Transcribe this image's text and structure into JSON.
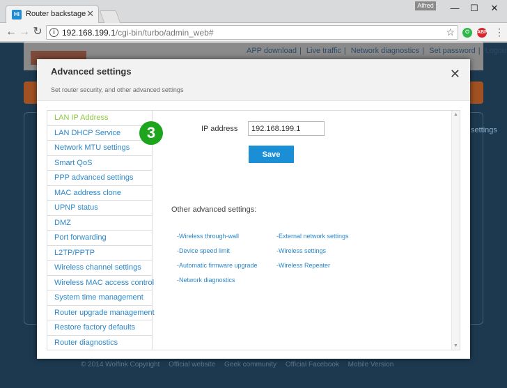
{
  "browser": {
    "tab_title": "Router backstage",
    "tab_favicon": "Hi",
    "user_name": "Alfred",
    "url_host": "192.168.199.1",
    "url_path": "/cgi-bin/turbo/admin_web#",
    "icons": {
      "back": "back-arrow-icon",
      "forward": "forward-arrow-icon",
      "reload": "reload-icon",
      "info": "info-icon",
      "star": "star-icon",
      "menu": "menu-icon"
    },
    "ext_abp": "ABP"
  },
  "background": {
    "header_links": [
      "APP download",
      "Live traffic",
      "Network diagnostics",
      "Set password",
      "Logout"
    ],
    "settings_text": "settings",
    "footer": [
      "© 2014 Wolfink Copyright",
      "Official website",
      "Geek community",
      "Official Facebook",
      "Mobile Version"
    ]
  },
  "modal": {
    "title": "Advanced settings",
    "subtitle": "Set router security, and other advanced settings",
    "step_number": "3",
    "menu": [
      "LAN IP Address",
      "LAN DHCP Service",
      "Network MTU settings",
      "Smart QoS",
      "PPP advanced settings",
      "MAC address clone",
      "UPNP status",
      "DMZ",
      "Port forwarding",
      "L2TP/PPTP",
      "Wireless channel settings",
      "Wireless MAC access control",
      "System time management",
      "Router upgrade management",
      "Restore factory defaults",
      "Router diagnostics"
    ],
    "active_color": "#8dc63f",
    "link_color": "#2b87c9",
    "ip_label": "IP address",
    "ip_value": "192.168.199.1",
    "save_label": "Save",
    "other_title": "Other advanced settings:",
    "other_links_left": [
      "-Wireless through-wall",
      "-Device speed limit",
      "-Automatic firmware upgrade",
      "-Network diagnostics"
    ],
    "other_links_right": [
      "-External network settings",
      "-Wireless settings",
      "-Wireless Repeater"
    ]
  }
}
